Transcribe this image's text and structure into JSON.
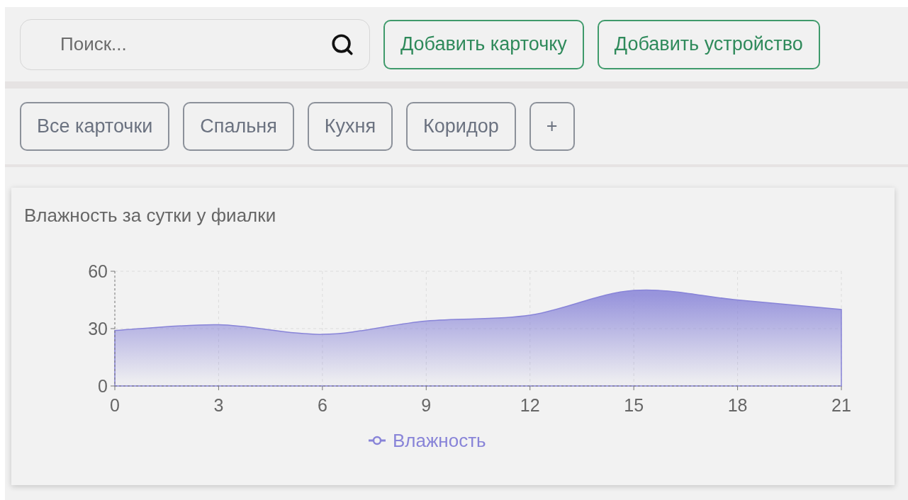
{
  "search": {
    "placeholder": "Поиск..."
  },
  "actions": [
    "Добавить карточку",
    "Добавить устройство"
  ],
  "rooms": [
    {
      "label": "Все карточки"
    },
    {
      "label": "Спальня"
    },
    {
      "label": "Кухня"
    },
    {
      "label": "Коридор"
    },
    {
      "label": "+"
    }
  ],
  "card": {
    "title": "Влажность за сутки у фиалки",
    "chart_data": {
      "type": "area",
      "x": [
        0,
        3,
        6,
        9,
        12,
        15,
        18,
        21
      ],
      "series": [
        {
          "name": "Влажность",
          "color": "#8884d8",
          "values": [
            29,
            32,
            27,
            34,
            37,
            50,
            45,
            40
          ]
        }
      ],
      "grid": true,
      "xlim": [
        0,
        21
      ],
      "ylim": [
        0,
        60
      ],
      "xticks": [
        0,
        3,
        6,
        9,
        12,
        15,
        18,
        21
      ],
      "yticks": [
        0,
        30,
        60
      ]
    }
  }
}
